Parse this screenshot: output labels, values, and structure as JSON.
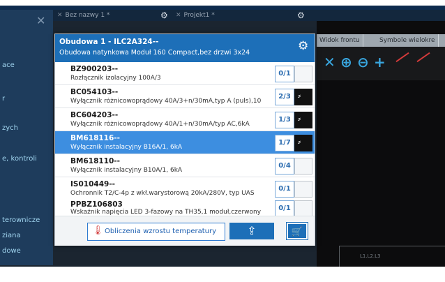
{
  "tabs": [
    {
      "label": "Bez nazwy 1 *"
    },
    {
      "label": "Projekt1 *"
    }
  ],
  "sidebar": {
    "items": [
      "ace",
      "r",
      "zych",
      "e, kontroli",
      "",
      "terownicze",
      "ziana",
      "dowe"
    ]
  },
  "view_tabs": [
    "Widok frontu",
    "Symbole wielokre"
  ],
  "toolbar_icons": [
    "zoom-fit-icon",
    "zoom-in-icon",
    "zoom-out-icon",
    "add-icon",
    "line-icon",
    "curve-icon"
  ],
  "drawing_label": "L1.L2.L3",
  "popup": {
    "title": "Obudowa 1 - ILC2A324--",
    "subtitle": "Obudowa natynkowa Moduł 160 Compact,bez drzwi 3x24",
    "items": [
      {
        "code": "BZ900203--",
        "desc": "Rozłącznik izolacyjny 100A/3",
        "qty": "0/1",
        "selected": false,
        "thumb": "light"
      },
      {
        "code": "BC054103--",
        "desc": "Wyłącznik różnicowoprądowy 40A/3+n/30mA,typ A (puls),10",
        "qty": "2/3",
        "selected": false,
        "thumb": "dark"
      },
      {
        "code": "BC604203--",
        "desc": "Wyłącznik różnicowoprądowy 40A/1+n/30mA/typ AC,6kA",
        "qty": "1/3",
        "selected": false,
        "thumb": "dark"
      },
      {
        "code": "BM618116--",
        "desc": "Wyłącznik instalacyjny B16A/1, 6kA",
        "qty": "1/7",
        "selected": true,
        "thumb": "dark"
      },
      {
        "code": "BM618110--",
        "desc": "Wyłącznik instalacyjny B10A/1, 6kA",
        "qty": "0/4",
        "selected": false,
        "thumb": "light"
      },
      {
        "code": "IS010449--",
        "desc": "Ochronnik T2/C-4p z wkł.warystorową 20kA/280V, typ UAS",
        "qty": "0/1",
        "selected": false,
        "thumb": "light"
      },
      {
        "code": "PPBZ106803",
        "desc": "Wskaźnik napięcia LED 3-fazowy na TH35,1 moduł,czerwony",
        "qty": "0/1",
        "selected": false,
        "thumb": "light"
      }
    ],
    "temp_button": "Obliczenia wzrostu temperatury"
  },
  "colors": {
    "header": "#1d6fb8",
    "selected_row": "#3d8ee0",
    "sidebar": "#1e3c5c"
  }
}
